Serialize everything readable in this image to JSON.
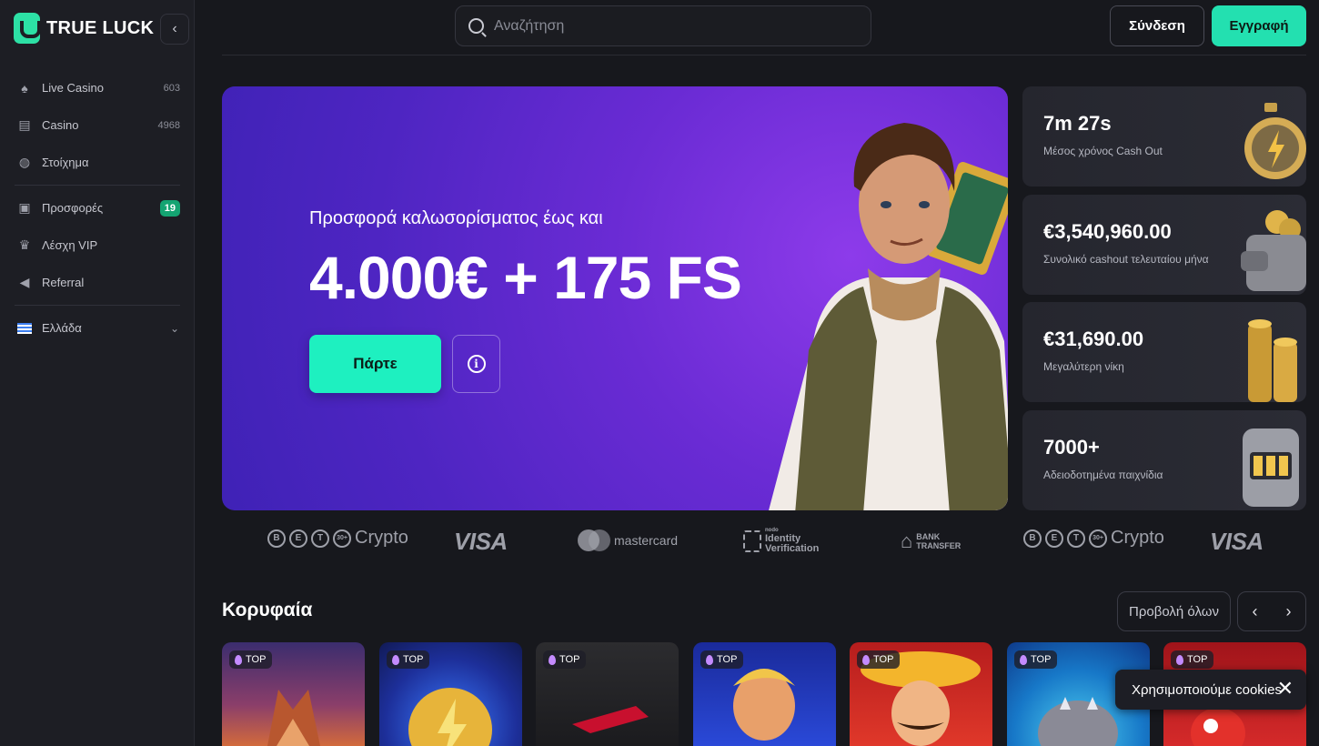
{
  "brand": {
    "name": "TRUE LUCK"
  },
  "sidebar": {
    "items": [
      {
        "label": "Live Casino",
        "count": "603",
        "icon": "spade-icon"
      },
      {
        "label": "Casino",
        "count": "4968",
        "icon": "slot-machine-icon"
      },
      {
        "label": "Στοίχημα",
        "count": "",
        "icon": "ball-icon"
      },
      {
        "label": "Προσφορές",
        "badge": "19",
        "icon": "gift-icon"
      },
      {
        "label": "Λέσχη VIP",
        "icon": "crown-icon"
      },
      {
        "label": "Referral",
        "icon": "megaphone-icon"
      }
    ],
    "language": {
      "label": "Ελλάδα",
      "icon": "greek-flag-icon"
    }
  },
  "header": {
    "search_placeholder": "Αναζήτηση",
    "login_label": "Σύνδεση",
    "register_label": "Εγγραφή"
  },
  "hero": {
    "subtitle": "Προσφορά καλωσορίσματος έως και",
    "title": "4.000€ + 175 FS",
    "cta_label": "Πάρτε",
    "info_icon": "info-icon"
  },
  "stats": [
    {
      "value": "7m 27s",
      "label": "Μέσος χρόνος Cash Out",
      "icon": "stopwatch-icon"
    },
    {
      "value": "€3,540,960.00",
      "label": "Συνολικό cashout τελευταίου μήνα",
      "icon": "wallet-icon"
    },
    {
      "value": "€31,690.00",
      "label": "Μεγαλύτερη νίκη",
      "icon": "coins-icon"
    },
    {
      "value": "7000+",
      "label": "Αδειοδοτημένα παιχνίδια",
      "icon": "slot-machine-icon"
    }
  ],
  "payments": {
    "crypto": "Crypto",
    "crypto_more": "30+",
    "visa": "VISA",
    "mastercard": "mastercard",
    "idv_small": "nodo",
    "idv_line1": "Identity",
    "idv_line2": "Verification",
    "bank_line1": "BANK",
    "bank_line2": "TRANSFER"
  },
  "top_section": {
    "title": "Κορυφαία",
    "view_all": "Προβολή όλων",
    "tag": "TOP",
    "games_count_visible": 7
  },
  "cookies": {
    "text": "Χρησιμοποιούμε cookies"
  },
  "colors": {
    "accent": "#23e0b0",
    "hero_purple": "#6a2bd4",
    "background": "#17181d",
    "badge_green": "#14a472"
  }
}
